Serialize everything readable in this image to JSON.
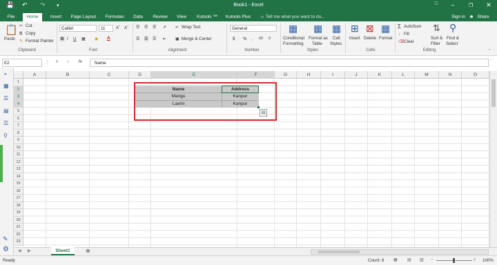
{
  "window": {
    "title": "Book1 - Excel"
  },
  "tabs": [
    {
      "label": "File"
    },
    {
      "label": "Home"
    },
    {
      "label": "Insert"
    },
    {
      "label": "Page Layout"
    },
    {
      "label": "Formulas"
    },
    {
      "label": "Data"
    },
    {
      "label": "Review"
    },
    {
      "label": "View"
    },
    {
      "label": "Kutools ™"
    },
    {
      "label": "Kutools Plus"
    }
  ],
  "tell_me": "Tell me what you want to do...",
  "account": {
    "sign_in": "Sign in",
    "share": "Share"
  },
  "ribbon": {
    "clipboard": {
      "paste": "Paste",
      "cut": "Cut",
      "copy": "Copy",
      "format_painter": "Format Painter",
      "label": "Clipboard"
    },
    "font": {
      "name": "Calibri",
      "size": "11",
      "label": "Font"
    },
    "alignment": {
      "wrap_text": "Wrap Text",
      "merge_center": "Merge & Center",
      "label": "Alignment"
    },
    "number": {
      "format": "General",
      "currency": "$",
      "percent": "%",
      "label": "Number"
    },
    "styles": {
      "conditional": "Conditional",
      "conditional2": "Formatting",
      "format_as": "Format as",
      "format_as2": "Table",
      "cell": "Cell",
      "cell2": "Styles",
      "label": "Styles"
    },
    "cells": {
      "insert": "Insert",
      "delete": "Delete",
      "format": "Format",
      "label": "Cells"
    },
    "editing": {
      "autosum": "AutoSum",
      "fill": "Fill",
      "clear": "Clear",
      "sort": "Sort &",
      "sort2": "Filter",
      "find": "Find &",
      "find2": "Select",
      "label": "Editing"
    }
  },
  "formula_bar": {
    "name_box": "E2",
    "fx": "fx",
    "value": "Name"
  },
  "columns": [
    "A",
    "B",
    "C",
    "D",
    "E",
    "F",
    "G",
    "H",
    "I",
    "J",
    "K",
    "L",
    "M",
    "N",
    "O"
  ],
  "rows": [
    "1",
    "2",
    "3",
    "4",
    "5",
    "6",
    "7",
    "8",
    "9",
    "10",
    "11",
    "12",
    "13",
    "14",
    "15",
    "16",
    "17",
    "18",
    "19",
    "20",
    "21",
    "22",
    "23"
  ],
  "table": {
    "headers": [
      "Name",
      "Address"
    ],
    "rows": [
      [
        "Mangu",
        "Kanpur"
      ],
      [
        "Laxmi",
        "Kanpur"
      ]
    ]
  },
  "sheet": {
    "name": "Sheet1"
  },
  "status": {
    "ready": "Ready",
    "count": "Count: 6",
    "zoom": "100%"
  },
  "colors": {
    "excel_green": "#217346",
    "selection_gray": "#c9c9c9",
    "highlight_red": "#d62828"
  }
}
